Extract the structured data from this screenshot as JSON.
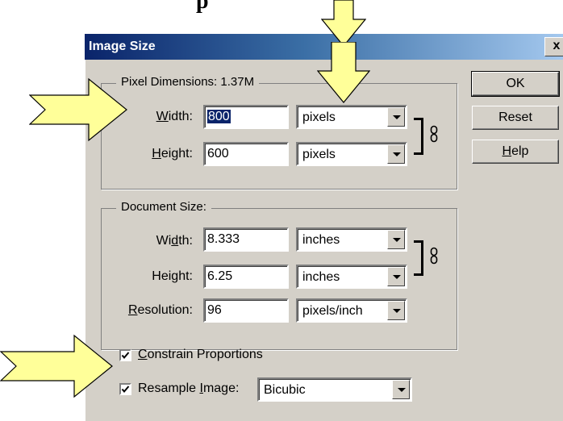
{
  "caption": {
    "text": "p"
  },
  "dialog": {
    "title": "Image Size",
    "close_glyph": "x",
    "buttons": {
      "ok": "OK",
      "reset": "Reset",
      "help_prefix": "",
      "help_mnemonic": "H",
      "help_suffix": "elp"
    }
  },
  "pixel_dimensions": {
    "legend": "Pixel Dimensions: 1.37M",
    "width": {
      "label_prefix": "",
      "label_mnemonic": "W",
      "label_suffix": "idth:",
      "value": "800",
      "unit": "pixels"
    },
    "height": {
      "label_prefix": "",
      "label_mnemonic": "H",
      "label_suffix": "eight:",
      "value": "600",
      "unit": "pixels"
    }
  },
  "document_size": {
    "legend": "Document Size:",
    "width": {
      "label_prefix": "Wi",
      "label_mnemonic": "d",
      "label_suffix": "th:",
      "value": "8.333",
      "unit": "inches"
    },
    "height": {
      "label_prefix": "Hei",
      "label_mnemonic": "g",
      "label_suffix": "ht:",
      "value": "6.25",
      "unit": "inches"
    },
    "resolution": {
      "label_prefix": "",
      "label_mnemonic": "R",
      "label_suffix": "esolution:",
      "value": "96",
      "unit": "pixels/inch"
    }
  },
  "options": {
    "constrain": {
      "checked": true,
      "label_prefix": "",
      "label_mnemonic": "C",
      "label_suffix": "onstrain Proportions"
    },
    "resample": {
      "checked": true,
      "label_prefix": "Resample ",
      "label_mnemonic": "I",
      "label_suffix": "mage:",
      "method": "Bicubic"
    }
  },
  "colors": {
    "arrow_fill": "#ffff99",
    "titlebar_start": "#0a246a",
    "titlebar_end": "#a6caf0",
    "dialog_face": "#d4d0c8"
  }
}
